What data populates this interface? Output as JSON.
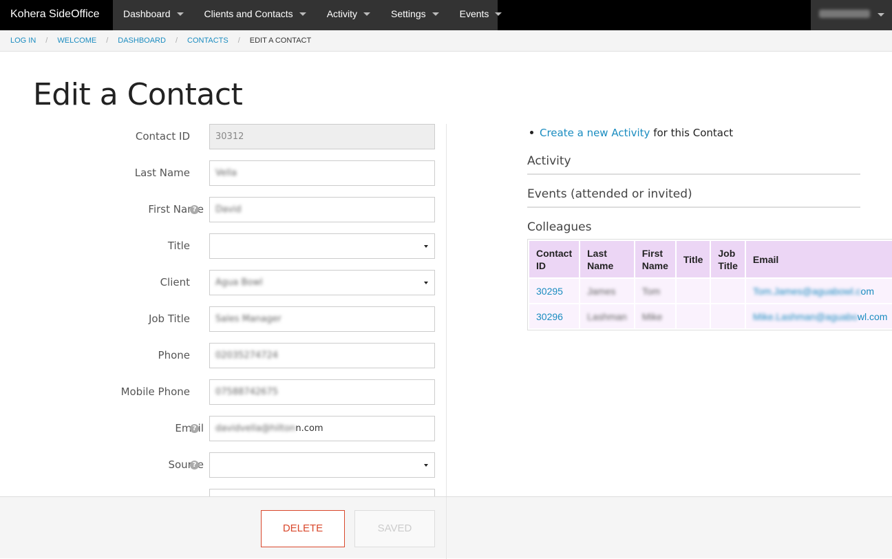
{
  "app": {
    "brand": "Kohera SideOffice"
  },
  "nav": {
    "items": [
      {
        "label": "Dashboard"
      },
      {
        "label": "Clients and Contacts"
      },
      {
        "label": "Activity"
      },
      {
        "label": "Settings"
      },
      {
        "label": "Events"
      }
    ]
  },
  "breadcrumb": [
    {
      "label": "LOG IN"
    },
    {
      "label": "WELCOME"
    },
    {
      "label": "DASHBOARD"
    },
    {
      "label": "CONTACTS"
    },
    {
      "label": "EDIT A CONTACT"
    }
  ],
  "page": {
    "title": "Edit a Contact"
  },
  "form": {
    "contact_id": {
      "label": "Contact ID",
      "value": "30312"
    },
    "last_name": {
      "label": "Last Name",
      "value": "Vella"
    },
    "first_name": {
      "label": "First Name",
      "value": "David"
    },
    "title": {
      "label": "Title",
      "value": ""
    },
    "client": {
      "label": "Client",
      "value": "Agua Bowl"
    },
    "job_title": {
      "label": "Job Title",
      "value": "Sales Manager"
    },
    "phone": {
      "label": "Phone",
      "value": "02035274724"
    },
    "mobile_phone": {
      "label": "Mobile Phone",
      "value": "07588742675"
    },
    "email": {
      "label": "Email",
      "value_blurred": "davidvella@hilton",
      "value_visible": "n.com"
    },
    "source": {
      "label": "Source",
      "value": ""
    }
  },
  "right": {
    "create_link": "Create a new Activity",
    "create_suffix": " for this Contact",
    "sections": {
      "activity": "Activity",
      "events": "Events (attended or invited)",
      "colleagues": "Colleagues"
    },
    "table": {
      "headers": {
        "contact_id_1": "Contact",
        "contact_id_2": "ID",
        "last_name_1": "Last",
        "last_name_2": "Name",
        "first_name_1": "First",
        "first_name_2": "Name",
        "title": "Title",
        "job_title_1": "Job",
        "job_title_2": "Title",
        "email": "Email"
      },
      "rows": [
        {
          "id": "30295",
          "last": "James",
          "first": "Tom",
          "title": "",
          "job": "",
          "email_blurred": "Tom.James@aguabowl.c",
          "email_visible": "om"
        },
        {
          "id": "30296",
          "last": "Lashman",
          "first": "Mike",
          "title": "",
          "job": "",
          "email_blurred": "Mike.Lashman@aguabo",
          "email_visible": "wl.com"
        }
      ]
    }
  },
  "footer": {
    "delete": "DELETE",
    "saved": "SAVED"
  },
  "colors": {
    "accent": "#1a8cc0",
    "danger": "#d9472b",
    "table_header": "#ecd6f5",
    "table_cell": "#faf2fd"
  }
}
